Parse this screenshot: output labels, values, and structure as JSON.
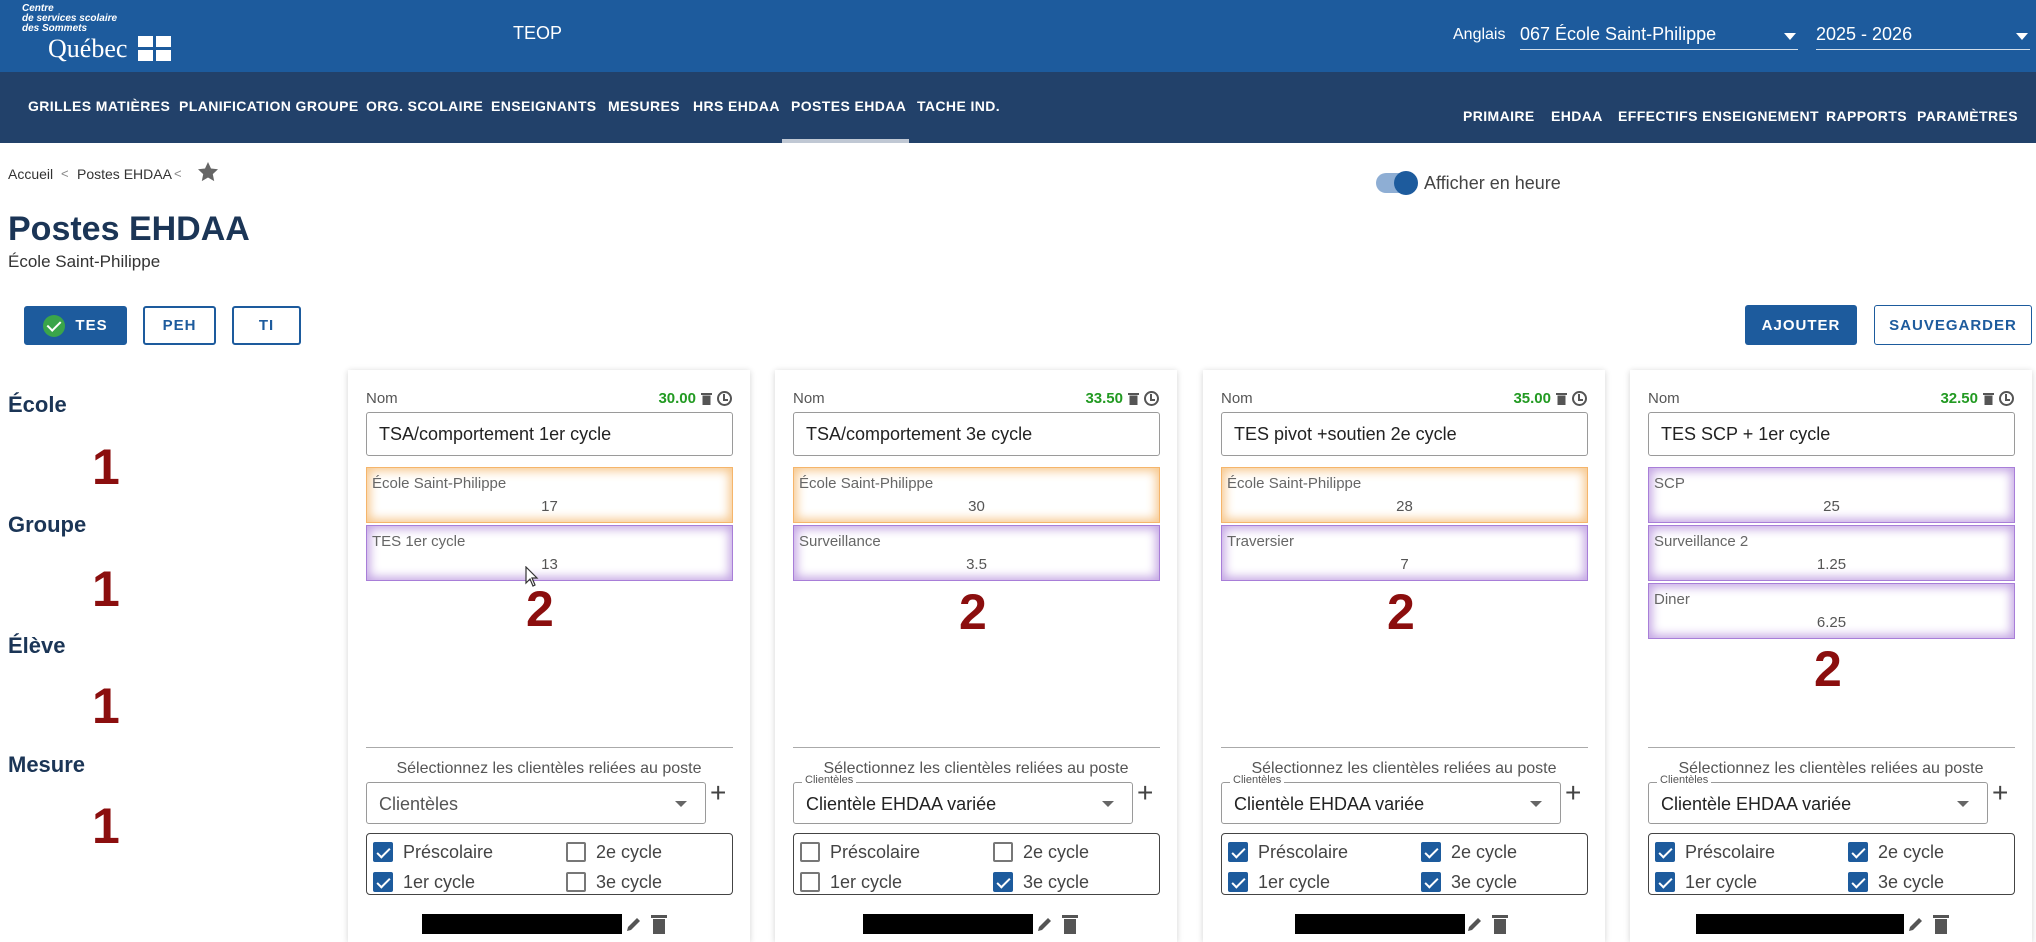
{
  "header": {
    "org_line": "Centre\nde services scolaire\ndes Sommets",
    "province": "Québec",
    "app_title": "TEOP",
    "language": "Anglais",
    "school_select": "067 École Saint-Philippe",
    "year_select": "2025 - 2026",
    "brand_color": "#1d5b9d"
  },
  "nav": {
    "left": [
      "GRILLES MATIÈRES",
      "PLANIFICATION GROUPE",
      "ORG. SCOLAIRE",
      "ENSEIGNANTS",
      "MESURES",
      "HRS EHDAA",
      "POSTES EHDAA",
      "TACHE IND."
    ],
    "right": [
      "PRIMAIRE",
      "EHDAA",
      "EFFECTIFS ENSEIGNEMENT",
      "RAPPORTS",
      "PARAMÈTRES"
    ],
    "active": "POSTES EHDAA"
  },
  "breadcrumb": {
    "home": "Accueil",
    "current": "Postes EHDAA"
  },
  "toggle_label": "Afficher en heure",
  "page": {
    "title": "Postes EHDAA",
    "subtitle": "École Saint-Philippe"
  },
  "tabs": [
    "TES",
    "PEH",
    "TI"
  ],
  "buttons": {
    "add": "AJOUTER",
    "save": "SAUVEGARDER"
  },
  "left_labels": [
    {
      "label": "École",
      "mark": "1"
    },
    {
      "label": "Groupe",
      "mark": "1"
    },
    {
      "label": "Élève",
      "mark": "1"
    },
    {
      "label": "Mesure",
      "mark": "1"
    }
  ],
  "cards": [
    {
      "nom_label": "Nom",
      "total": "30.00",
      "name": "TSA/comportement 1er cycle",
      "allocations": [
        {
          "label": "École Saint-Philippe",
          "value": "17",
          "tone": "orange"
        },
        {
          "label": "TES 1er cycle",
          "value": "13",
          "tone": "purple"
        }
      ],
      "mark": "2",
      "select_text": "Sélectionnez les clientèles reliées au poste",
      "clientele_legend": "",
      "clientele_value": "Clientèles",
      "checks": [
        {
          "label": "Préscolaire",
          "checked": true
        },
        {
          "label": "2e cycle",
          "checked": false
        },
        {
          "label": "1er cycle",
          "checked": true
        },
        {
          "label": "3e cycle",
          "checked": false
        }
      ]
    },
    {
      "nom_label": "Nom",
      "total": "33.50",
      "name": "TSA/comportement 3e cycle",
      "allocations": [
        {
          "label": "École Saint-Philippe",
          "value": "30",
          "tone": "orange"
        },
        {
          "label": "Surveillance",
          "value": "3.5",
          "tone": "purple"
        }
      ],
      "mark": "2",
      "select_text": "Sélectionnez les clientèles reliées au poste",
      "clientele_legend": "Clientèles",
      "clientele_value": "Clientèle EHDAA variée",
      "checks": [
        {
          "label": "Préscolaire",
          "checked": false
        },
        {
          "label": "2e cycle",
          "checked": false
        },
        {
          "label": "1er cycle",
          "checked": false
        },
        {
          "label": "3e cycle",
          "checked": true
        }
      ]
    },
    {
      "nom_label": "Nom",
      "total": "35.00",
      "name": "TES pivot +soutien 2e cycle",
      "allocations": [
        {
          "label": "École Saint-Philippe",
          "value": "28",
          "tone": "orange"
        },
        {
          "label": "Traversier",
          "value": "7",
          "tone": "purple"
        }
      ],
      "mark": "2",
      "select_text": "Sélectionnez les clientèles reliées au poste",
      "clientele_legend": "Clientèles",
      "clientele_value": "Clientèle EHDAA variée",
      "checks": [
        {
          "label": "Préscolaire",
          "checked": true
        },
        {
          "label": "2e cycle",
          "checked": true
        },
        {
          "label": "1er cycle",
          "checked": true
        },
        {
          "label": "3e cycle",
          "checked": true
        }
      ]
    },
    {
      "nom_label": "Nom",
      "total": "32.50",
      "name": "TES SCP + 1er cycle",
      "allocations": [
        {
          "label": "SCP",
          "value": "25",
          "tone": "purple"
        },
        {
          "label": "Surveillance 2",
          "value": "1.25",
          "tone": "purple"
        },
        {
          "label": "Diner",
          "value": "6.25",
          "tone": "purple"
        }
      ],
      "mark": "2",
      "select_text": "Sélectionnez les clientèles reliées au poste",
      "clientele_legend": "Clientèles",
      "clientele_value": "Clientèle EHDAA variée",
      "checks": [
        {
          "label": "Préscolaire",
          "checked": true
        },
        {
          "label": "2e cycle",
          "checked": true
        },
        {
          "label": "1er cycle",
          "checked": true
        },
        {
          "label": "3e cycle",
          "checked": true
        }
      ]
    }
  ]
}
